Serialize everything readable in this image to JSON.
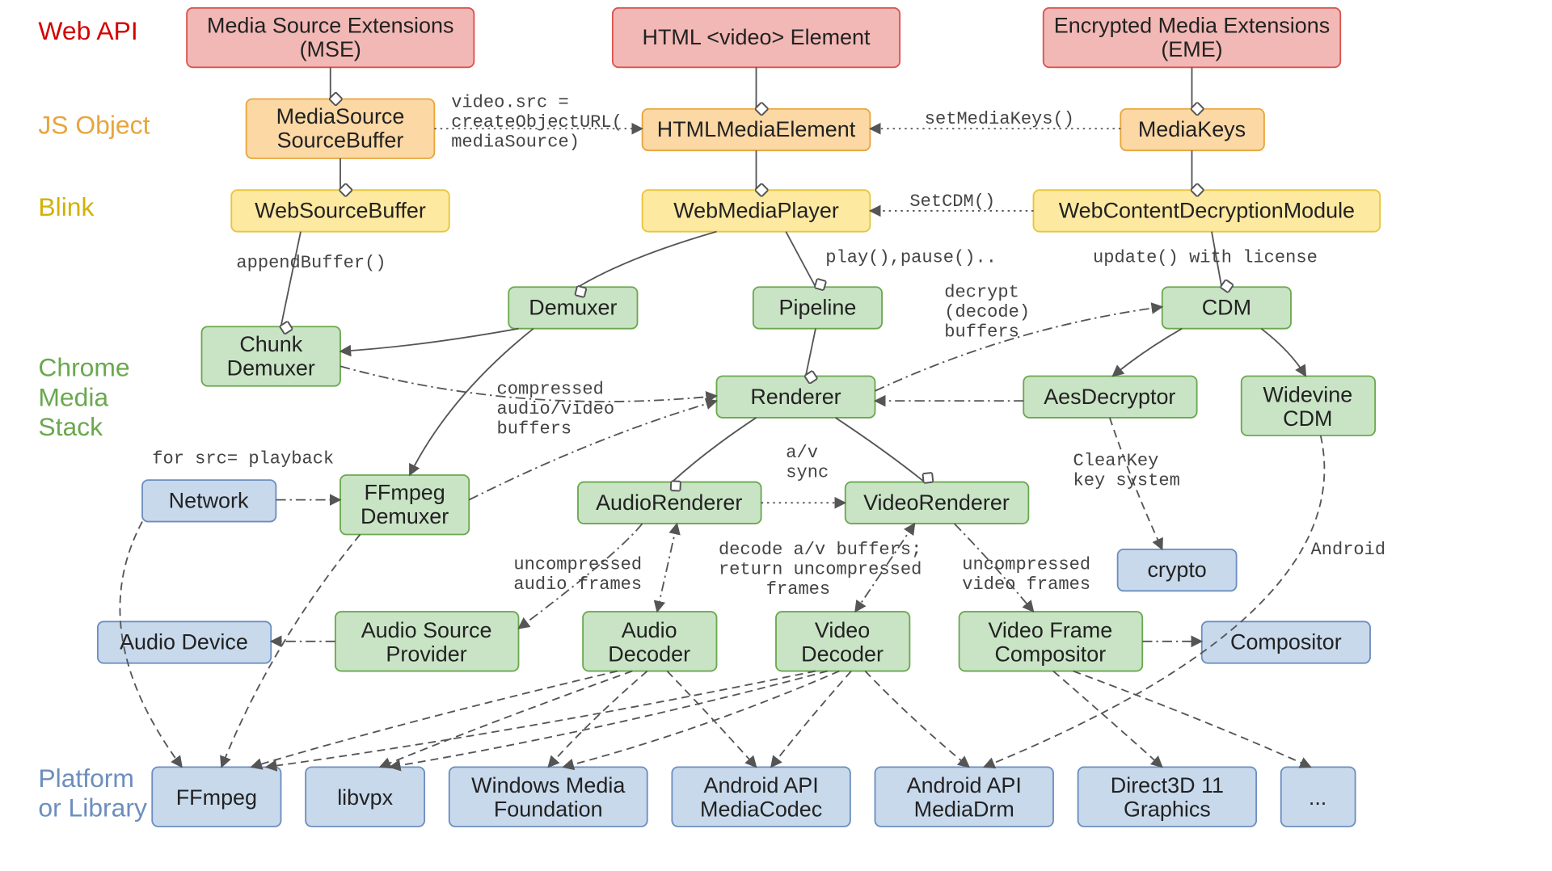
{
  "layers": {
    "web_api": "Web API",
    "js_object": "JS Object",
    "blink": "Blink",
    "chrome_media_stack_1": "Chrome",
    "chrome_media_stack_2": "Media",
    "chrome_media_stack_3": "Stack",
    "platform_1": "Platform",
    "platform_2": "or Library"
  },
  "boxes": {
    "mse_1": "Media Source Extensions",
    "mse_2": "(MSE)",
    "video_el": "HTML <video> Element",
    "eme_1": "Encrypted Media Extensions",
    "eme_2": "(EME)",
    "mediasource_1": "MediaSource",
    "mediasource_2": "SourceBuffer",
    "htmlmedia": "HTMLMediaElement",
    "mediakeys": "MediaKeys",
    "websourcebuffer": "WebSourceBuffer",
    "webmediaplayer": "WebMediaPlayer",
    "webcdm": "WebContentDecryptionModule",
    "chunkdemuxer_1": "Chunk",
    "chunkdemuxer_2": "Demuxer",
    "demuxer": "Demuxer",
    "pipeline": "Pipeline",
    "cdm": "CDM",
    "renderer": "Renderer",
    "aesdecryptor": "AesDecryptor",
    "widevine_1": "Widevine",
    "widevine_2": "CDM",
    "network": "Network",
    "ffmpegdemuxer_1": "FFmpeg",
    "ffmpegdemuxer_2": "Demuxer",
    "audiorenderer": "AudioRenderer",
    "videorenderer": "VideoRenderer",
    "crypto": "crypto",
    "audiodevice": "Audio Device",
    "asp_1": "Audio Source",
    "asp_2": "Provider",
    "audiodecoder_1": "Audio",
    "audiodecoder_2": "Decoder",
    "videodecoder_1": "Video",
    "videodecoder_2": "Decoder",
    "vfc_1": "Video Frame",
    "vfc_2": "Compositor",
    "compositor": "Compositor",
    "ffmpeg": "FFmpeg",
    "libvpx": "libvpx",
    "wmf_1": "Windows Media",
    "wmf_2": "Foundation",
    "mediacodec_1": "Android API",
    "mediacodec_2": "MediaCodec",
    "mediadrm_1": "Android API",
    "mediadrm_2": "MediaDrm",
    "d3d_1": "Direct3D 11",
    "d3d_2": "Graphics",
    "more": "..."
  },
  "ann": {
    "createurl_1": "video.src =",
    "createurl_2": "createObjectURL(",
    "createurl_3": "mediaSource)",
    "setmediakeys": "setMediaKeys()",
    "setcdm": "SetCDM()",
    "appendbuffer": "appendBuffer()",
    "playpause": "play(),pause()..",
    "update": "update() with license",
    "decrypt_1": "decrypt",
    "decrypt_2": "(decode)",
    "decrypt_3": "buffers",
    "compressed_1": "compressed",
    "compressed_2": "audio/video",
    "compressed_3": "buffers",
    "forsrc": "for src= playback",
    "avsync_1": "a/v",
    "avsync_2": "sync",
    "clearkey_1": "ClearKey",
    "clearkey_2": "key system",
    "android": "Android",
    "unc_audio_1": "uncompressed",
    "unc_audio_2": "audio frames",
    "decode_1": "decode a/v buffers;",
    "decode_2": "return uncompressed",
    "decode_3": "frames",
    "unc_video_1": "uncompressed",
    "unc_video_2": "video frames"
  }
}
